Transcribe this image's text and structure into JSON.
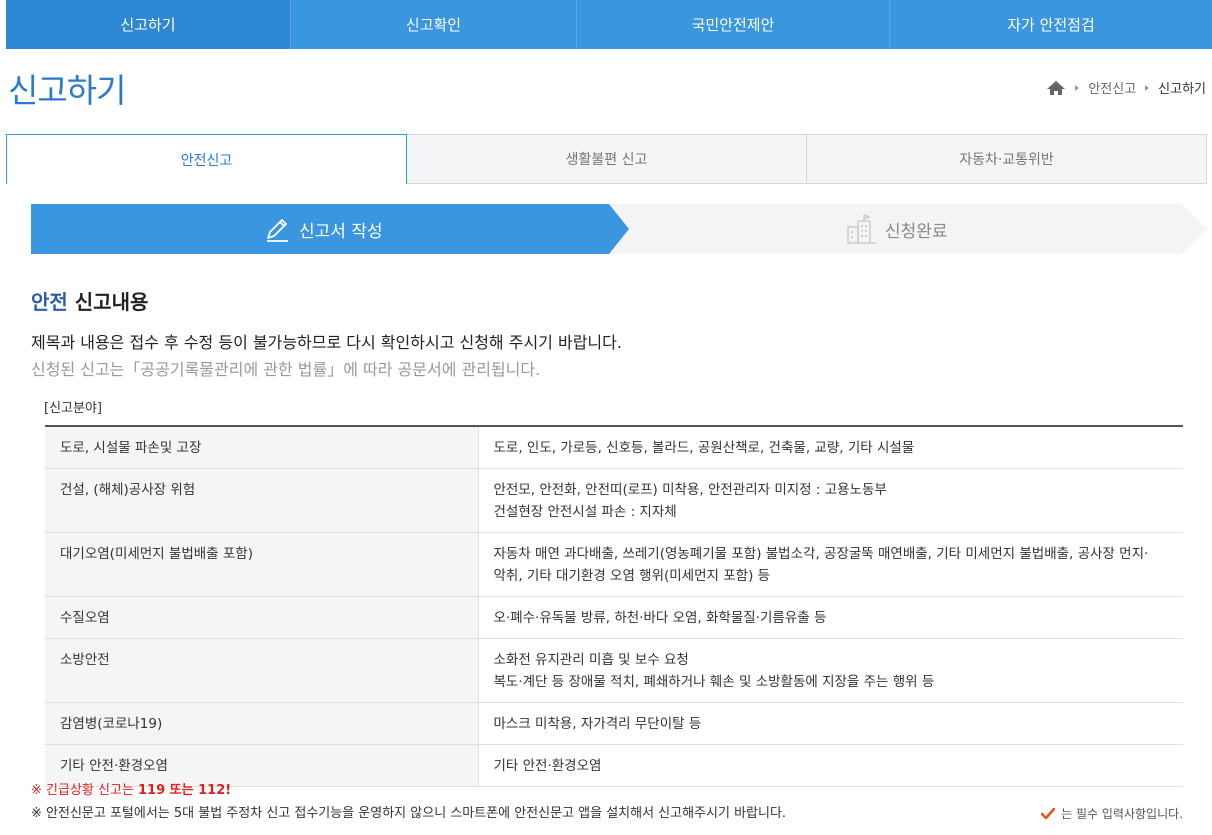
{
  "topnav": [
    {
      "label": "신고하기",
      "active": true
    },
    {
      "label": "신고확인",
      "active": false
    },
    {
      "label": "국민안전제안",
      "active": false
    },
    {
      "label": "자가 안전점검",
      "active": false
    }
  ],
  "page_title": "신고하기",
  "breadcrumb": {
    "home_icon": "home-icon",
    "items": [
      "안전신고",
      "신고하기"
    ]
  },
  "tabs": [
    {
      "label": "안전신고",
      "active": true
    },
    {
      "label": "생활불편 신고",
      "active": false
    },
    {
      "label": "자동차·교통위반",
      "active": false
    }
  ],
  "steps": [
    {
      "label": "신고서 작성",
      "icon": "pencil-icon",
      "active": true
    },
    {
      "label": "신청완료",
      "icon": "building-icon",
      "active": false
    }
  ],
  "section": {
    "title_highlight": "안전",
    "title_rest": " 신고내용",
    "notice1": "제목과 내용은 접수 후 수정 등이 불가능하므로 다시 확인하시고 신청해 주시기 바랍니다.",
    "notice2": "신청된 신고는「공공기록물관리에 관한 법률」에 따라 공문서에 관리됩니다."
  },
  "category_label": "[신고분야]",
  "categories": [
    {
      "name": "도로, 시설물 파손및 고장",
      "desc": [
        "도로, 인도, 가로등, 신호등, 볼라드, 공원산책로, 건축물, 교량, 기타 시설물"
      ]
    },
    {
      "name": "건설, (해체)공사장 위험",
      "desc": [
        "안전모, 안전화, 안전띠(로프) 미착용, 안전관리자 미지정 : 고용노동부",
        "건설현장 안전시설 파손 : 지자체"
      ]
    },
    {
      "name": "대기오염(미세먼지 불법배출 포함)",
      "desc": [
        "자동차 매연 과다배출, 쓰레기(영농폐기물 포함) 불법소각, 공장굴뚝 매연배출, 기타 미세먼지 불법배출, 공사장 먼지·",
        "악취, 기타 대기환경 오염 행위(미세먼지 포함) 등"
      ]
    },
    {
      "name": "수질오염",
      "desc": [
        "오·폐수·유독물 방류, 하천·바다 오염, 화학물질·기름유출 등"
      ]
    },
    {
      "name": "소방안전",
      "desc": [
        "소화전 유지관리 미흡 및 보수 요청",
        "복도·계단 등 장애물 적치, 폐쇄하거나 훼손 및 소방활동에 지장을 주는 행위 등"
      ]
    },
    {
      "name": "감염병(코로나19)",
      "desc": [
        "마스크 미착용, 자가격리 무단이탈 등"
      ]
    },
    {
      "name": "기타 안전·환경오염",
      "desc": [
        "기타 안전·환경오염"
      ]
    }
  ],
  "emergency": {
    "prefix": "※ 긴급상황 신고는 ",
    "numbers": "119 또는 112!"
  },
  "footnote": "※ 안전신문고 포털에서는 5대 불법 주정차 신고 접수기능을 운영하지 않으니 스마트폰에 안전신문고 앱을 설치해서 신고해주시기 바랍니다.",
  "required_note": "는 필수 입력사항입니다.",
  "colors": {
    "primary": "#3a96de",
    "title": "#2b7bc9",
    "emergency": "#e02020",
    "check": "#e8541c"
  }
}
